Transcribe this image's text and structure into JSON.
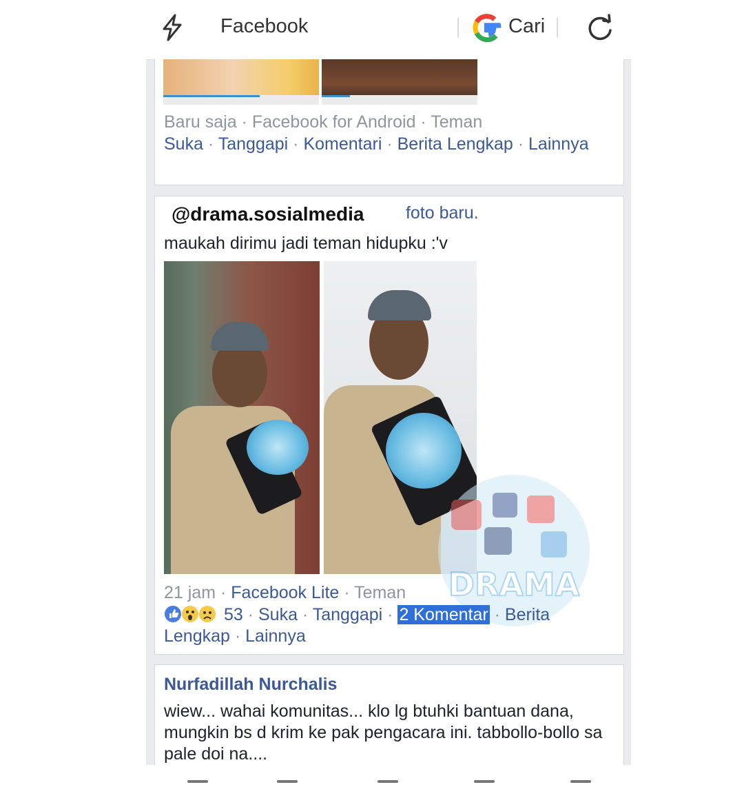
{
  "topbar": {
    "title": "Facebook",
    "search_label": "Cari",
    "icons": [
      "lightning-icon",
      "google-icon",
      "refresh-icon"
    ]
  },
  "post1": {
    "meta": "Baru saja · Facebook for Android · Teman",
    "actions": [
      "Suka",
      "Tanggapi",
      "Komentari",
      "Berita Lengkap",
      "Lainnya"
    ]
  },
  "post2": {
    "poster_suffix": "foto baru.",
    "watermark": "@drama.sosialmedia",
    "caption": "maukah dirimu jadi teman hidupku :'v",
    "meta": {
      "time": "21 jam",
      "app": "Facebook Lite",
      "audience": "Teman"
    },
    "reaction_count": "53",
    "actions": {
      "like": "Suka",
      "react": "Tanggapi",
      "comments": "2 Komentar",
      "story": "Berita Lengkap",
      "more": "Lainnya"
    },
    "watermark_logo_text": "DRAMA"
  },
  "post3": {
    "commenter": "Nurfadillah Nurchalis",
    "comment": "wiew... wahai komunitas... klo lg btuhki bantuan dana, mungkin bs d krim ke pak pengacara ini. tabbollo-bollo sa pale doi na...."
  },
  "colors": {
    "link": "#3b5998",
    "meta": "#90949c",
    "highlight": "#2f6fd8",
    "feed_bg": "#e9ebee"
  }
}
